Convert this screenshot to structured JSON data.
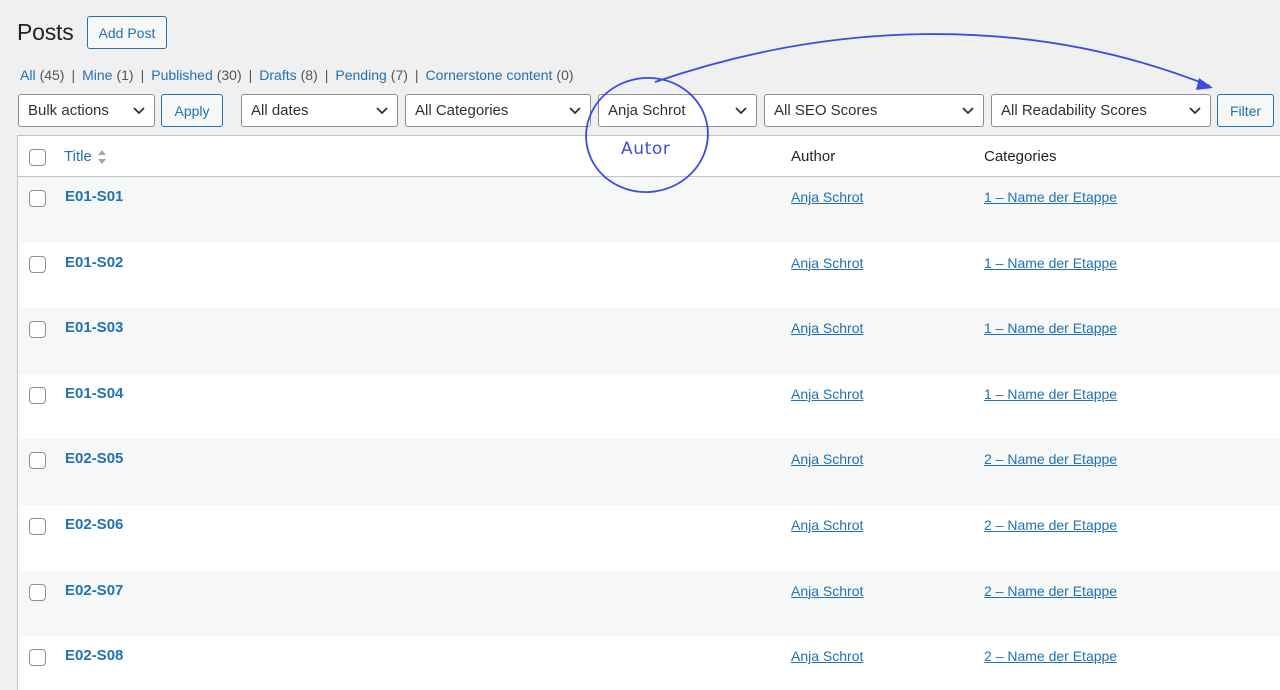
{
  "header": {
    "title": "Posts",
    "add_button": "Add Post"
  },
  "status_filters": [
    {
      "label": "All",
      "count": "(45)"
    },
    {
      "label": "Mine",
      "count": "(1)"
    },
    {
      "label": "Published",
      "count": "(30)"
    },
    {
      "label": "Drafts",
      "count": "(8)"
    },
    {
      "label": "Pending",
      "count": "(7)"
    },
    {
      "label": "Cornerstone content",
      "count": "(0)"
    }
  ],
  "filters": {
    "bulk_actions": "Bulk actions",
    "apply": "Apply",
    "dates": "All dates",
    "categories": "All Categories",
    "author": "Anja Schrot",
    "seo": "All SEO Scores",
    "readability": "All Readability Scores",
    "filter_button": "Filter"
  },
  "table": {
    "columns": {
      "title": "Title",
      "author": "Author",
      "categories": "Categories"
    },
    "rows": [
      {
        "title": "E01-S01",
        "author": "Anja Schrot",
        "category": "1 – Name der Etappe"
      },
      {
        "title": "E01-S02",
        "author": "Anja Schrot",
        "category": "1 – Name der Etappe"
      },
      {
        "title": "E01-S03",
        "author": "Anja Schrot",
        "category": "1 – Name der Etappe"
      },
      {
        "title": "E01-S04",
        "author": "Anja Schrot",
        "category": "1 – Name der Etappe"
      },
      {
        "title": "E02-S05",
        "author": "Anja Schrot",
        "category": "2 – Name der Etappe"
      },
      {
        "title": "E02-S06",
        "author": "Anja Schrot",
        "category": "2 – Name der Etappe"
      },
      {
        "title": "E02-S07",
        "author": "Anja Schrot",
        "category": "2 – Name der Etappe"
      },
      {
        "title": "E02-S08",
        "author": "Anja Schrot",
        "category": "2 – Name der Etappe"
      }
    ]
  },
  "annotation": {
    "label": "Autor",
    "color": "#3d4ce0"
  },
  "colors": {
    "link": "#2271b1",
    "background": "#f0f0f1"
  },
  "icons": {
    "dropdown": "chevron-down-icon",
    "sort": "sort-arrows-icon"
  }
}
